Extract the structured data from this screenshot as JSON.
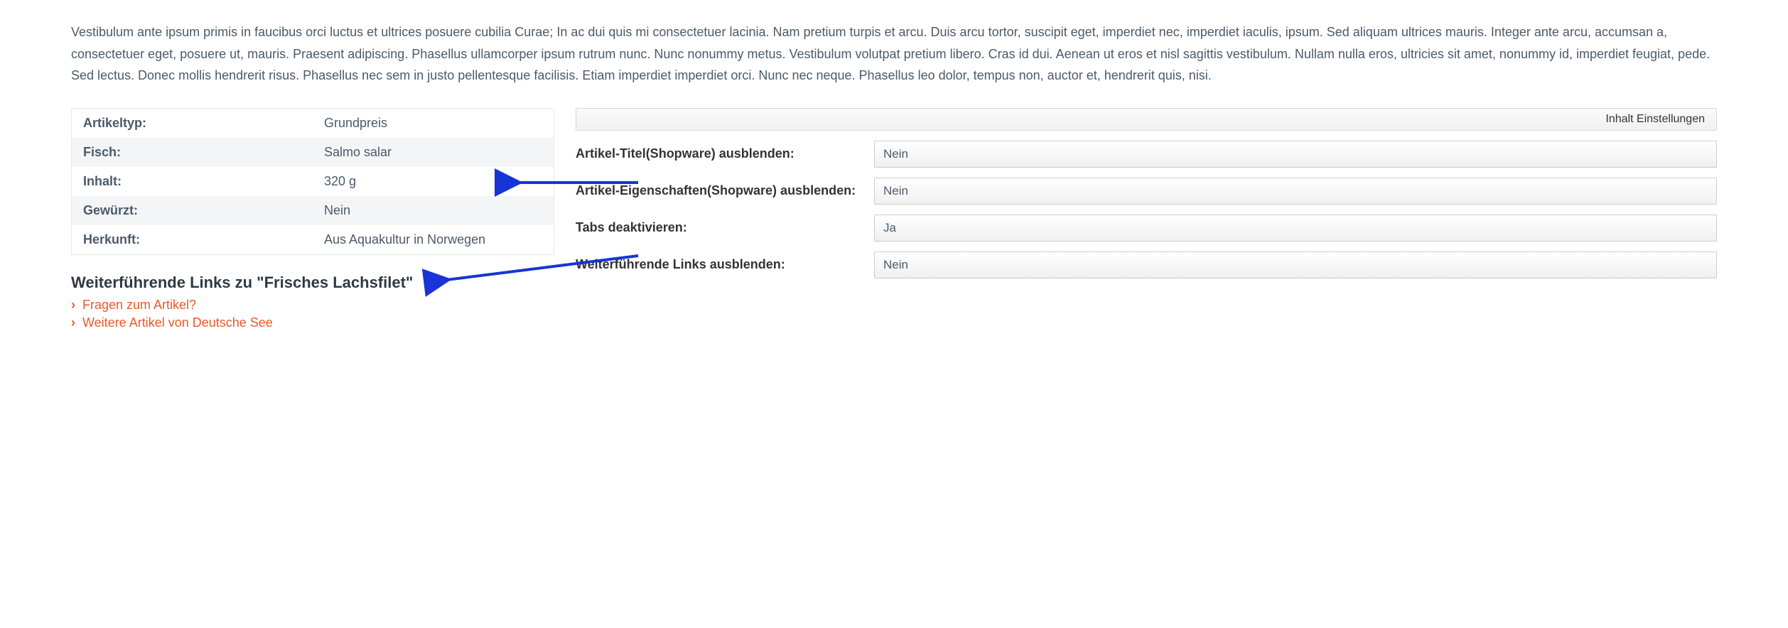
{
  "description": "Vestibulum ante ipsum primis in faucibus orci luctus et ultrices posuere cubilia Curae; In ac dui quis mi consectetuer lacinia. Nam pretium turpis et arcu. Duis arcu tortor, suscipit eget, imperdiet nec, imperdiet iaculis, ipsum. Sed aliquam ultrices mauris. Integer ante arcu, accumsan a, consectetuer eget, posuere ut, mauris. Praesent adipiscing. Phasellus ullamcorper ipsum rutrum nunc. Nunc nonummy metus. Vestibulum volutpat pretium libero. Cras id dui. Aenean ut eros et nisl sagittis vestibulum. Nullam nulla eros, ultricies sit amet, nonummy id, imperdiet feugiat, pede. Sed lectus. Donec mollis hendrerit risus. Phasellus nec sem in justo pellentesque facilisis. Etiam imperdiet imperdiet orci. Nunc nec neque. Phasellus leo dolor, tempus non, auctor et, hendrerit quis, nisi.",
  "properties": {
    "rows": [
      {
        "label": "Artikeltyp:",
        "value": "Grundpreis"
      },
      {
        "label": "Fisch:",
        "value": "Salmo salar"
      },
      {
        "label": "Inhalt:",
        "value": "320 g"
      },
      {
        "label": "Gewürzt:",
        "value": "Nein"
      },
      {
        "label": "Herkunft:",
        "value": "Aus Aquakultur in Norwegen"
      }
    ]
  },
  "links_heading": "Weiterführende Links zu \"Frisches Lachsfilet\"",
  "links": [
    "Fragen zum Artikel?",
    "Weitere Artikel von Deutsche See"
  ],
  "panel_title": "Inhalt Einstellungen",
  "settings": [
    {
      "label": "Artikel-Titel(Shopware) ausblenden:",
      "value": "Nein"
    },
    {
      "label": "Artikel-Eigenschaften(Shopware) ausblenden:",
      "value": "Nein"
    },
    {
      "label": "Tabs deaktivieren:",
      "value": "Ja"
    },
    {
      "label": "Weiterführende Links ausblenden:",
      "value": "Nein"
    }
  ]
}
